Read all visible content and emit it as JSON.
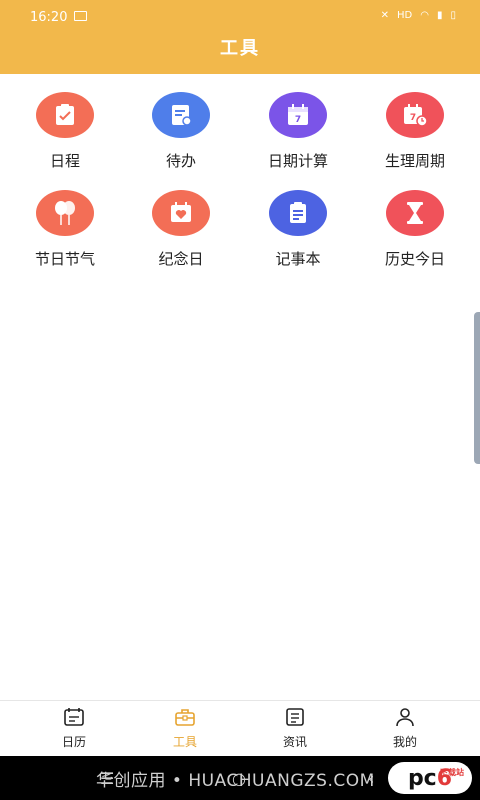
{
  "status_bar": {
    "time": "16:20",
    "right_text": "HD"
  },
  "header": {
    "title": "工具"
  },
  "tools": [
    {
      "label": "日程",
      "icon": "clipboard-check-icon",
      "color": "#F36E56"
    },
    {
      "label": "待办",
      "icon": "note-pencil-icon",
      "color": "#4F7EEA"
    },
    {
      "label": "日期计算",
      "icon": "calendar-7-icon",
      "color": "#7B54E8"
    },
    {
      "label": "生理周期",
      "icon": "calendar-clock-icon",
      "color": "#F0525A"
    },
    {
      "label": "节日节气",
      "icon": "balloons-icon",
      "color": "#F36E56"
    },
    {
      "label": "纪念日",
      "icon": "heart-calendar-icon",
      "color": "#F36E56"
    },
    {
      "label": "记事本",
      "icon": "clipboard-list-icon",
      "color": "#4D63E2"
    },
    {
      "label": "历史今日",
      "icon": "hourglass-icon",
      "color": "#F0525A"
    }
  ],
  "tabbar": [
    {
      "label": "日历",
      "icon": "calendar-icon"
    },
    {
      "label": "工具",
      "icon": "toolbox-icon",
      "active": true
    },
    {
      "label": "资讯",
      "icon": "news-icon"
    },
    {
      "label": "我的",
      "icon": "user-icon"
    }
  ],
  "accent_color": "#F2B84B",
  "nav_watermark": "华创应用 • HUACHUANGZS.COM",
  "corner_watermark": {
    "prefix": "pc",
    "digit": "6",
    "small": "下载站"
  }
}
